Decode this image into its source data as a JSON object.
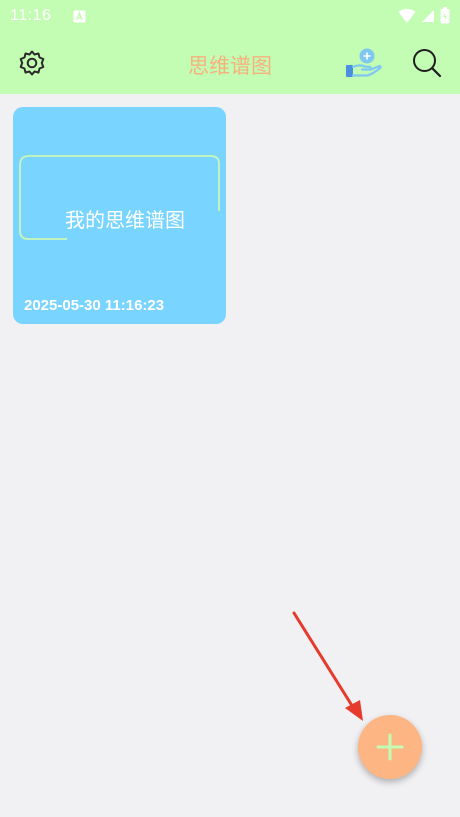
{
  "status_bar": {
    "time": "11:16"
  },
  "toolbar": {
    "title": "思维谱图",
    "icons": {
      "left": "gear-icon",
      "middle": "share-hand-icon",
      "right": "search-icon"
    }
  },
  "mind_maps": [
    {
      "node_text": "我的思维谱图",
      "date": "2025-05-30 11:16:23"
    }
  ],
  "fab": {
    "icon": "plus-icon"
  },
  "colors": {
    "bar_background": "#c3fcb3",
    "title": "#f5b27e",
    "card": "#79d4ff",
    "fab": "#fdb583",
    "fab_icon": "#c3fcb3",
    "annotation_arrow": "#e53a2c"
  }
}
